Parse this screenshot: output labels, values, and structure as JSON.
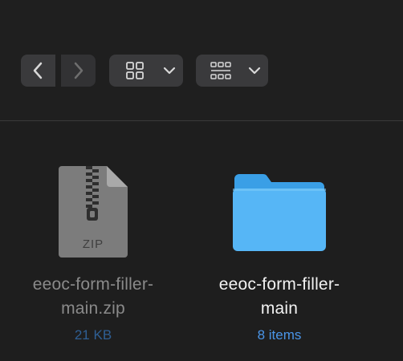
{
  "toolbar": {
    "back_icon": "chevron-left-icon",
    "forward_icon": "chevron-right-icon",
    "view_icon": "grid-view-icon",
    "gallery_icon": "gallery-view-icon",
    "dropdown_icon": "chevron-down-icon"
  },
  "items": [
    {
      "icon": "zip-archive-icon",
      "name_line1": "eeoc-form-filler-",
      "name_line2": "main.zip",
      "meta": "21 KB",
      "badge": "ZIP",
      "dimmed": true
    },
    {
      "icon": "folder-icon",
      "name_line1": "eeoc-form-filler-",
      "name_line2": "main",
      "meta": "8 items",
      "dimmed": false
    }
  ],
  "colors": {
    "background": "#1e1e1e",
    "button": "#3a3a3c",
    "folder": "#4fb3f6",
    "zip_meta": "#2f5f94",
    "folder_meta": "#4a95e8"
  }
}
